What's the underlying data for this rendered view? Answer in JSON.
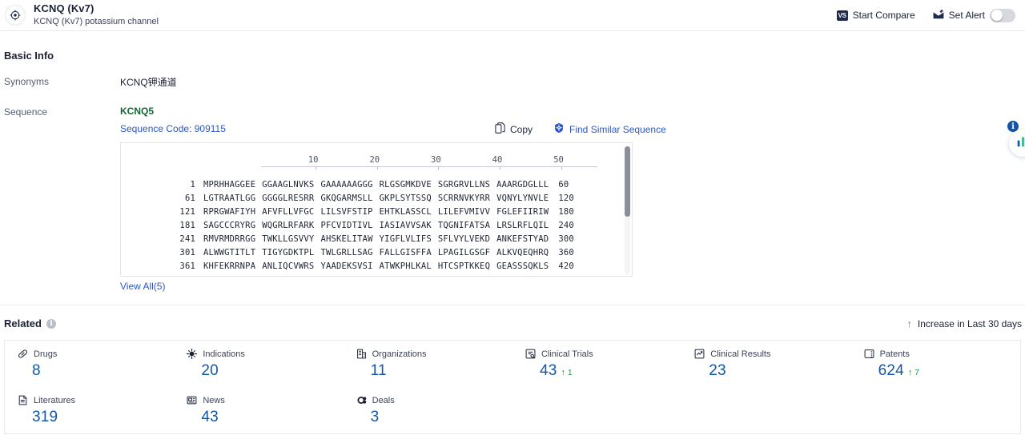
{
  "header": {
    "icon": "target-icon",
    "title": "KCNQ (Kv7)",
    "subtitle": "KCNQ (Kv7) potassium channel",
    "start_compare_label": "Start Compare",
    "start_compare_badge": "VS",
    "set_alert_label": "Set Alert",
    "set_alert_toggle_state": "off"
  },
  "basic_info": {
    "section_title": "Basic Info",
    "synonyms_label": "Synonyms",
    "synonyms_value": "KCNQ钾通道",
    "sequence_label": "Sequence",
    "sequence_name": "KCNQ5",
    "sequence_code": "Sequence Code: 909115",
    "copy_label": "Copy",
    "find_similar_label": "Find Similar Sequence",
    "view_all_label": "View All(5)"
  },
  "sequence_viewer": {
    "ruler_ticks": [
      10,
      20,
      30,
      40,
      50
    ],
    "rows": [
      {
        "start": "1",
        "chunks": [
          "MPRHHAGGEE",
          "GGAAGLNVKS",
          "GAAAAAAGGG",
          "RLGSGMKDVE",
          "SGRGRVLLNS",
          "AAARGDGLLL"
        ],
        "end": "60"
      },
      {
        "start": "61",
        "chunks": [
          "LGTRAATLGG",
          "GGGGLRESRR",
          "GKQGARMSLL",
          "GKPLSYTSSQ",
          "SCRRNVKYRR",
          "VQNYLYNVLE"
        ],
        "end": "120"
      },
      {
        "start": "121",
        "chunks": [
          "RPRGWAFIYH",
          "AFVFLLVFGC",
          "LILSVFSTIP",
          "EHTKLASSCL",
          "LILEFVMIVV",
          "FGLEFIIRIW"
        ],
        "end": "180"
      },
      {
        "start": "181",
        "chunks": [
          "SAGCCCRYRG",
          "WQGRLRFARK",
          "PFCVIDTIVL",
          "IASIAVVSAK",
          "TQGNIFATSA",
          "LRSLRFLQIL"
        ],
        "end": "240"
      },
      {
        "start": "241",
        "chunks": [
          "RMVRMDRRGG",
          "TWKLLGSVVY",
          "AHSKELITAW",
          "YIGFLVLIFS",
          "SFLVYLVEKD",
          "ANKEFSTYAD"
        ],
        "end": "300"
      },
      {
        "start": "301",
        "chunks": [
          "ALWWGTITLT",
          "TIGYGDKTPL",
          "TWLGRLLSAG",
          "FALLGISFFA",
          "LPAGILGSGF",
          "ALKVQEQHRQ"
        ],
        "end": "360"
      },
      {
        "start": "361",
        "chunks": [
          "KHFEKRRNPA",
          "ANLIQCVWRS",
          "YAADEKSVSI",
          "ATWKPHLKAL",
          "HTCSPTKKEQ",
          "GEASSSQKLS"
        ],
        "end": "420"
      }
    ]
  },
  "related": {
    "title": "Related",
    "info_glyph": "i",
    "legend_label": "Increase in Last 30 days",
    "legend_arrow": "↑",
    "cards": [
      {
        "label": "Drugs",
        "icon": "pill-icon",
        "value": "8",
        "delta": ""
      },
      {
        "label": "Indications",
        "icon": "virus-icon",
        "value": "20",
        "delta": ""
      },
      {
        "label": "Organizations",
        "icon": "building-icon",
        "value": "11",
        "delta": ""
      },
      {
        "label": "Clinical Trials",
        "icon": "clinical-trial-icon",
        "value": "43",
        "delta": "1"
      },
      {
        "label": "Clinical Results",
        "icon": "clinical-result-icon",
        "value": "23",
        "delta": ""
      },
      {
        "label": "Patents",
        "icon": "patent-icon",
        "value": "624",
        "delta": "7"
      },
      {
        "label": "Literatures",
        "icon": "literature-icon",
        "value": "319",
        "delta": ""
      },
      {
        "label": "News",
        "icon": "news-icon",
        "value": "43",
        "delta": ""
      },
      {
        "label": "Deals",
        "icon": "deal-icon",
        "value": "3",
        "delta": ""
      }
    ]
  },
  "floating": {
    "info_glyph": "i",
    "fab_icon": "chart-icon"
  },
  "colors": {
    "link": "#2b58c6",
    "stat_value": "#1257a6",
    "increase": "#18913c",
    "sequence_name": "#166534"
  }
}
